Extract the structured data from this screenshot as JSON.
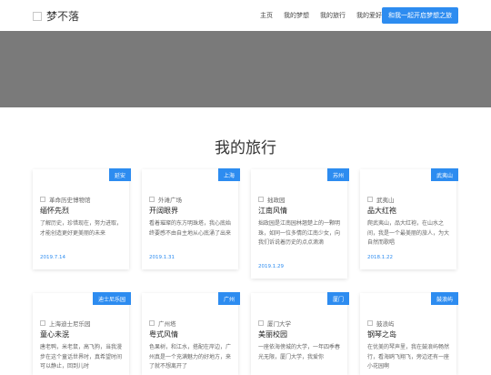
{
  "header": {
    "brand": "梦不落",
    "nav": [
      "主页",
      "我的梦想",
      "我的旅行",
      "我的爱好"
    ],
    "cta": "和我一起开启梦想之旅"
  },
  "section": {
    "title": "我的旅行"
  },
  "cards": [
    {
      "tag": "延安",
      "location": "革命历史博物馆",
      "title": "缅怀先烈",
      "desc": "了解历史，珍惜现在，努力进取，才能创造更好更美丽的未来",
      "date": "2019.7.14"
    },
    {
      "tag": "上海",
      "location": "外滩广场",
      "title": "开阔眼界",
      "desc": "看着璀璨的东方明珠塔，我心底始终要感不由自主地从心底涌了出来",
      "date": "2019.1.31"
    },
    {
      "tag": "苏州",
      "location": "拙政园",
      "title": "江南风情",
      "desc": "拙政园是江南园林翘楚上的一颗明珠，如同一位多情的江南少女，向我们诉说着历史的点点滴滴",
      "date": "2019.1.29"
    },
    {
      "tag": "武夷山",
      "location": "武夷山",
      "title": "品大红袍",
      "desc": "爬武夷山，品大红袍，在山水之间，我是一个最美丽的旅人，为大自然而歌唱",
      "date": "2018.1.22"
    },
    {
      "tag": "迪士尼乐园",
      "location": "上海迪士尼乐园",
      "title": "童心未泯",
      "desc": "唐老鸭，米老鼠，高飞狗，当我漫步在这个童话世界时，真希望时间可以静止，回到儿时",
      "date": ""
    },
    {
      "tag": "广州",
      "location": "广州塔",
      "title": "粤式风情",
      "desc": "色果树，和江水，搭配在岸边，广州真是一个充满魅力的好地方，来了就不想离开了",
      "date": ""
    },
    {
      "tag": "厦门",
      "location": "厦门大学",
      "title": "美丽校园",
      "desc": "一座依海傍城的大学，一年四季春光无限，厦门大学，我爱你",
      "date": ""
    },
    {
      "tag": "鼓浪屿",
      "location": "鼓浪屿",
      "title": "钢琴之岛",
      "desc": "在优美的琴声里，我在鼓浪屿畅然行，看海鸥飞翔飞，旁边还有一座小花园啊",
      "date": ""
    }
  ],
  "colors": {
    "accent": "#2d8cf0",
    "banner": "#7a7a7a"
  }
}
